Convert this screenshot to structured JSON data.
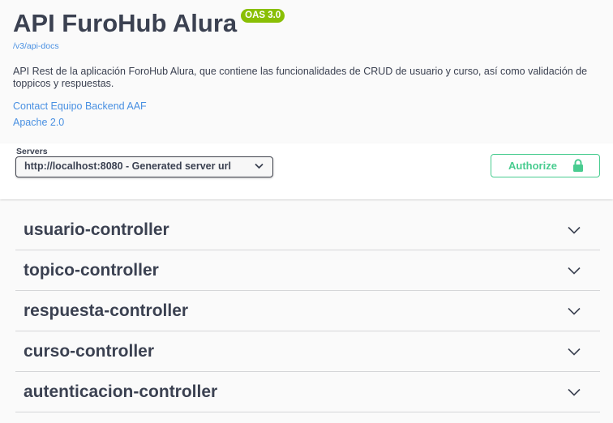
{
  "info": {
    "title": "API FuroHub Alura",
    "version_badge": "OAS 3.0",
    "docs_link": "/v3/api-docs",
    "description_line1": "API Rest de la aplicación ForoHub Alura, que contiene las funcionalidades de CRUD de usuario y curso, así como validación de",
    "description_line2": "toppicos y respuestas.",
    "contact": "Contact Equipo Backend AAF",
    "license": "Apache 2.0"
  },
  "servers": {
    "label": "Servers",
    "selected": "http://localhost:8080 - Generated server url"
  },
  "authorize": {
    "label": "Authorize",
    "icon": "lock-icon"
  },
  "tags": [
    {
      "name": "usuario-controller"
    },
    {
      "name": "topico-controller"
    },
    {
      "name": "respuesta-controller"
    },
    {
      "name": "curso-controller"
    },
    {
      "name": "autenticacion-controller"
    }
  ],
  "colors": {
    "badge": "#89bf04",
    "link": "#4990e2",
    "authorize": "#49cc90",
    "text": "#3b4151"
  }
}
